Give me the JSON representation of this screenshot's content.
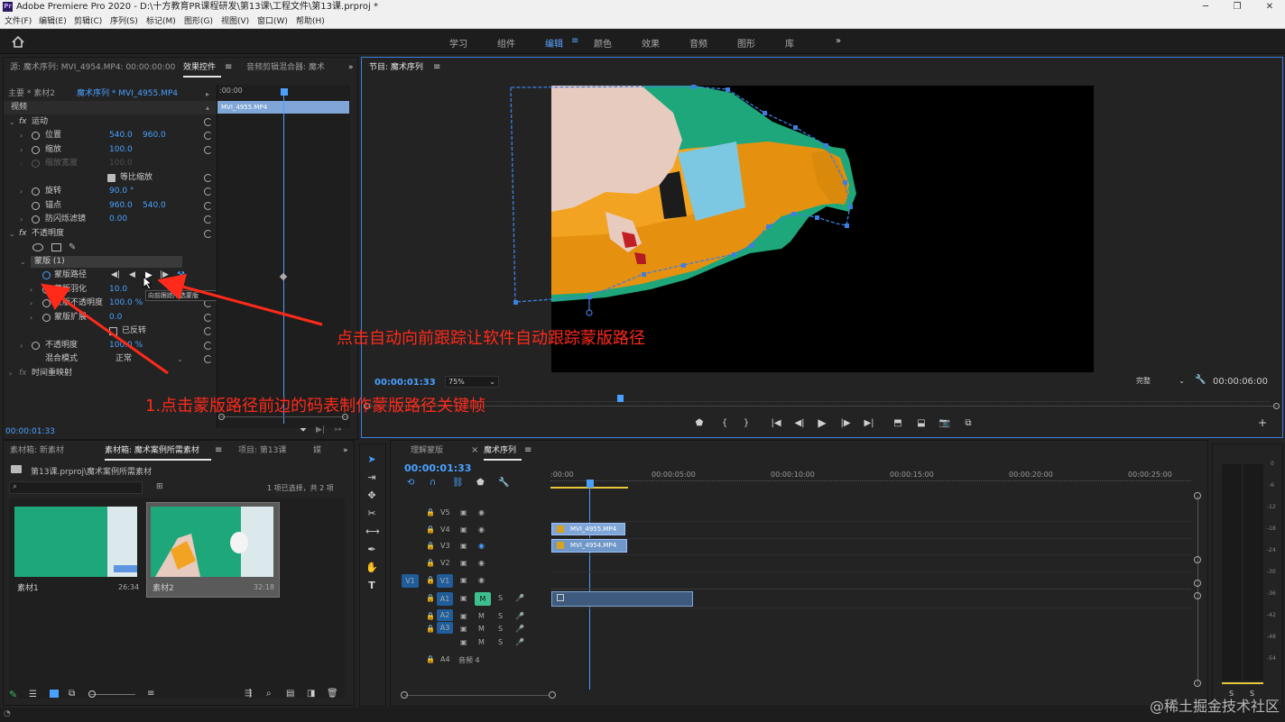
{
  "window": {
    "app_icon": "Pr",
    "title": "Adobe Premiere Pro 2020 - D:\\十方教育PR课程研发\\第13课\\工程文件\\第13课.prproj *",
    "controls": [
      "─",
      "❐",
      "✕"
    ]
  },
  "menu": [
    "文件(F)",
    "编辑(E)",
    "剪辑(C)",
    "序列(S)",
    "标记(M)",
    "图形(G)",
    "视图(V)",
    "窗口(W)",
    "帮助(H)"
  ],
  "workspaces": {
    "home_icon": "home-icon",
    "items": [
      "学习",
      "组件",
      "编辑",
      "颜色",
      "效果",
      "音频",
      "图形",
      "库"
    ],
    "active": "编辑",
    "more": "»"
  },
  "effect_controls": {
    "tab_source": "源: 魔术序列: MVI_4954.MP4: 00:00:00:00",
    "tab_active": "效果控件",
    "tab_audio": "音频剪辑混合器: 魔术",
    "more": "»",
    "master": "主要 * 素材2",
    "sequence": "魔术序列 * MVI_4955.MP4",
    "video_header": "视频",
    "motion": "运动",
    "position": {
      "label": "位置",
      "x": "540.0",
      "y": "960.0"
    },
    "scale": {
      "label": "缩放",
      "value": "100.0"
    },
    "scale_width": {
      "label": "缩放宽度",
      "value": "100.0"
    },
    "uniform": "等比缩放",
    "rotation": {
      "label": "旋转",
      "value": "90.0 °"
    },
    "anchor": {
      "label": "锚点",
      "x": "960.0",
      "y": "540.0"
    },
    "flicker": {
      "label": "防闪烁滤镜",
      "value": "0.00"
    },
    "opacity_group": "不透明度",
    "mask": "蒙版 (1)",
    "mask_path": "蒙版路径",
    "mask_feather": {
      "label": "蒙版羽化",
      "value": "10.0"
    },
    "mask_opacity": {
      "label": "蒙版不透明度",
      "value": "100.0 %"
    },
    "mask_expansion": {
      "label": "蒙版扩展",
      "value": "0.0"
    },
    "inverted": "已反转",
    "opacity": {
      "label": "不透明度",
      "value": "100.0 %"
    },
    "blend": {
      "label": "混合模式",
      "value": "正常"
    },
    "time_remap": "时间重映射",
    "tooltip": "向前跟踪所选蒙版",
    "timecode": "00:00:01:33",
    "mini_timeline": {
      "start": ":00:00",
      "clip": "MVI_4955.MP4"
    }
  },
  "program": {
    "tab": "节目: 魔术序列",
    "timecode": "00:00:01:33",
    "zoom": "75%",
    "quality": "完整",
    "duration": "00:00:06:00"
  },
  "bins": {
    "tab1": "素材箱: 新素材",
    "tab2": "素材箱: 魔术案例所需素材",
    "tab3": "项目: 第13课",
    "tab4": "媒",
    "more": "»",
    "path": "第13课.prproj\\魔术案例所需素材",
    "count": "1 项已选择，共 2 项",
    "items": [
      {
        "name": "素材1",
        "duration": "26:34"
      },
      {
        "name": "素材2",
        "duration": "32:18"
      }
    ]
  },
  "timeline": {
    "tab1": "理解蒙版",
    "tab2": "魔术序列",
    "timecode": "00:00:01:33",
    "ruler": [
      ":00:00",
      "00:00:05:00",
      "00:00:10:00",
      "00:00:15:00",
      "00:00:20:00",
      "00:00:25:00"
    ],
    "video_tracks": [
      "V5",
      "V4",
      "V3",
      "V2",
      "V1"
    ],
    "audio_tracks": [
      "A1",
      "A2",
      "A3",
      "A4"
    ],
    "audio4_name": "音频 4",
    "source_v": "V1",
    "clips": [
      "MVI_4955.MP4",
      "MVI_4954.MP4"
    ]
  },
  "meter": {
    "labels": [
      "S",
      "S"
    ],
    "ticks": [
      "0",
      "-6",
      "-12",
      "-18",
      "-24",
      "-30",
      "-36",
      "-42",
      "-48",
      "-54"
    ]
  },
  "annotations": {
    "auto_track": "点击自动向前跟踪让软件自动跟踪蒙版路径",
    "stopwatch": "1.点击蒙版路径前边的码表制作蒙版路径关键帧"
  },
  "watermark": "@稀土掘金技术社区",
  "colors": {
    "accent": "#4aa0ff",
    "annotation": "#ff2a1a",
    "mask": "#3d7fe0",
    "green_screen": "#1fa77c"
  }
}
